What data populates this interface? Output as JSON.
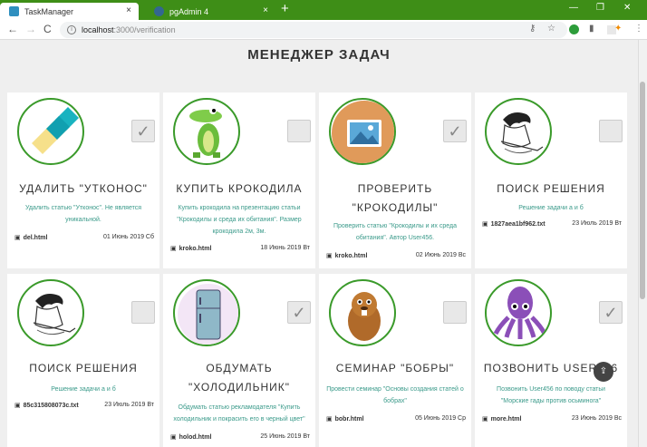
{
  "browser": {
    "tabs": [
      {
        "label": "TaskManager",
        "close": "×"
      },
      {
        "label": "pgAdmin 4",
        "close": "×"
      }
    ],
    "new_tab": "+",
    "window_controls": [
      "—",
      "❐",
      "✕"
    ],
    "url_host": "localhost",
    "url_path": ":3000/verification",
    "nav": [
      "←",
      "→",
      "C"
    ]
  },
  "page": {
    "title": "МЕНЕДЖЕР ЗАДАЧ"
  },
  "cards": [
    {
      "title": "УДАЛИТЬ \"УТКОНОС\"",
      "desc": "Удалить статью \"Утконос\". Не является уникальной.",
      "file": "del.html",
      "date": "01 Июнь 2019 Сб",
      "checked": true,
      "icon": "eraser-icon"
    },
    {
      "title": "КУПИТЬ КРОКОДИЛА",
      "desc": "Купить крокодила на презентацию статьи \"Крокодилы и среда их обитания\". Размер крокодила 2м, 3м.",
      "file": "kroko.html",
      "date": "18 Июнь 2019 Вт",
      "checked": false,
      "icon": "crocodile-icon"
    },
    {
      "title": "ПРОВЕРИТЬ \"КРОКОДИЛЫ\"",
      "desc": "Проверить статью \"Крокодилы и их среда обитания\". Автор User456.",
      "file": "kroko.html",
      "date": "02 Июнь 2019 Вс",
      "checked": true,
      "icon": "image-icon"
    },
    {
      "title": "ПОИСК РЕШЕНИЯ",
      "desc": "Решение задачи а и б",
      "file": "1827aea1bf962.txt",
      "date": "23 Июль 2019 Вт",
      "checked": false,
      "icon": "thinker-icon"
    },
    {
      "title": "ПОИСК РЕШЕНИЯ",
      "desc": "Решение задачи а и б",
      "file": "85c315808073c.txt",
      "date": "23 Июль 2019 Вт",
      "checked": false,
      "icon": "thinker-icon"
    },
    {
      "title": "ОБДУМАТЬ \"ХОЛОДИЛЬНИК\"",
      "desc": "Обдумать статью рекламодателя \"Купить холодильник и покрасить его в черный цвет\"",
      "file": "holod.html",
      "date": "25 Июнь 2019 Вт",
      "checked": true,
      "icon": "fridge-icon"
    },
    {
      "title": "СЕМИНАР \"БОБРЫ\"",
      "desc": "Провести семинар \"Основы создания статей о бобрах\"",
      "file": "bobr.html",
      "date": "05 Июнь 2019 Ср",
      "checked": false,
      "icon": "beaver-icon"
    },
    {
      "title": "ПОЗВОНИТЬ USER456",
      "desc": "Позвонить User456 по поводу статьи \"Морские гады против осьминога\"",
      "file": "more.html",
      "date": "23 Июнь 2019 Вс",
      "checked": true,
      "icon": "octopus-icon"
    }
  ],
  "fab": "⇪"
}
